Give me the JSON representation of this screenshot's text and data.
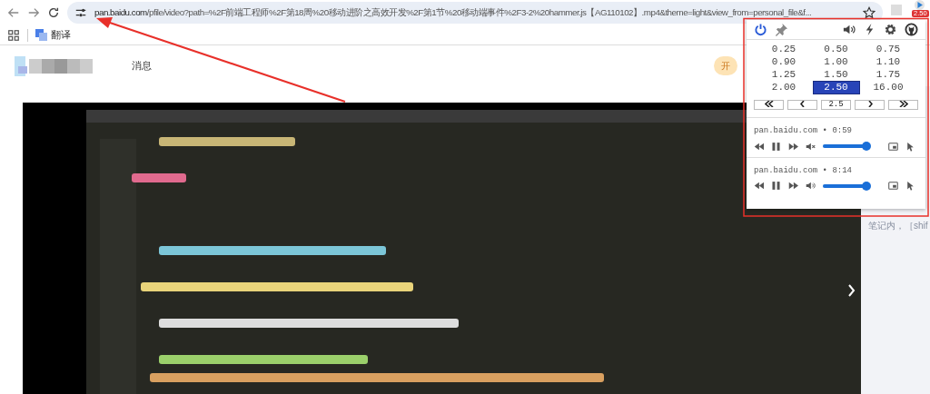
{
  "address_bar": {
    "host": "pan.baidu.com",
    "rest": "/pfile/video?path=%2F前端工程师%2F第18周%20移动进阶之高效开发%2F第1节%20移动端事件%2F3-2%20hammer.js【AG110102】.mp4&theme=light&view_from=personal_file&f..."
  },
  "extension_badge": "2.50",
  "bookmarks": [
    {
      "label": "翻译"
    }
  ],
  "site_header": {
    "nav_link": "消息",
    "promo": "开"
  },
  "side_panel": {
    "hint": "笔记内，［shif"
  },
  "popup": {
    "enabled": true,
    "pinned": false,
    "speeds": [
      {
        "label": "0.25",
        "selected": false
      },
      {
        "label": "0.50",
        "selected": false
      },
      {
        "label": "0.75",
        "selected": false
      },
      {
        "label": "0.90",
        "selected": false
      },
      {
        "label": "1.00",
        "selected": false
      },
      {
        "label": "1.10",
        "selected": false
      },
      {
        "label": "1.25",
        "selected": false
      },
      {
        "label": "1.50",
        "selected": false
      },
      {
        "label": "1.75",
        "selected": false
      },
      {
        "label": "2.00",
        "selected": false
      },
      {
        "label": "2.50",
        "selected": true
      },
      {
        "label": "16.00",
        "selected": false
      }
    ],
    "speed_input": "2.5",
    "media": [
      {
        "title": "pan.baidu.com • 0:59",
        "muted": true,
        "level": 1
      },
      {
        "title": "pan.baidu.com • 8:14",
        "muted": false,
        "level": 1
      }
    ]
  }
}
